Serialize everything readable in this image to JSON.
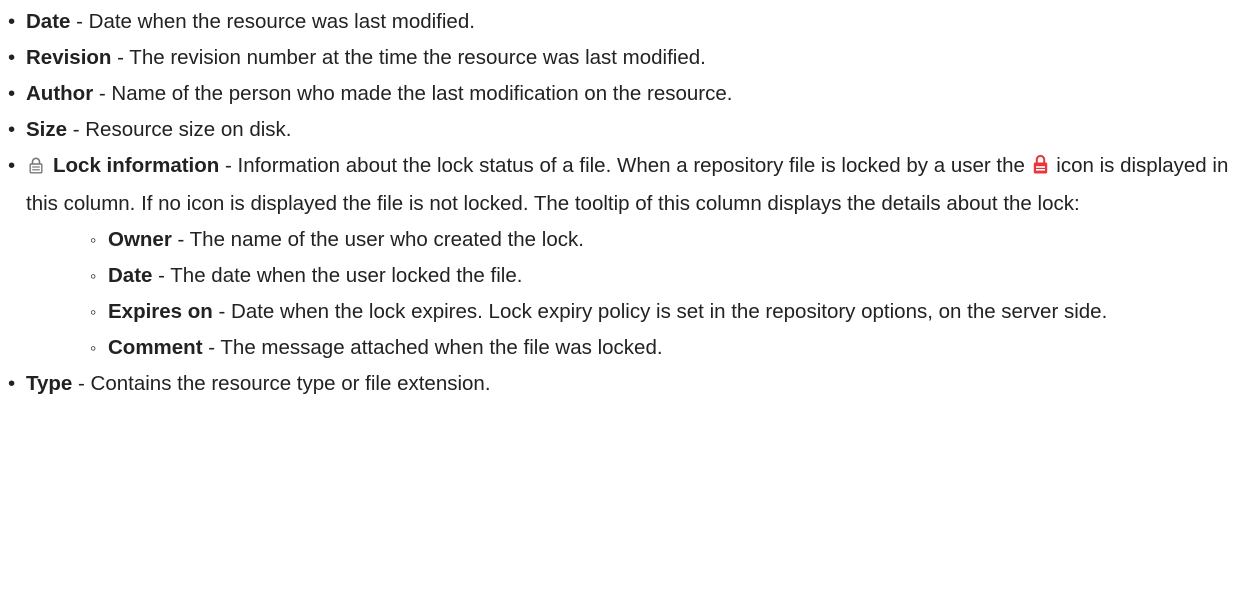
{
  "items": [
    {
      "term": "Date",
      "desc": " - Date when the resource was last modified."
    },
    {
      "term": "Revision",
      "desc": " - The revision number at the time the resource was last modified."
    },
    {
      "term": "Author",
      "desc": " - Name of the person who made the last modification on the resource."
    },
    {
      "term": "Size",
      "desc": " - Resource size on disk."
    }
  ],
  "lock_item": {
    "icon": "lock-gray-icon",
    "term": "Lock information",
    "desc_before_icon": " - Information about the lock status of a file. When a repository file is locked by a user the ",
    "inline_icon": "lock-red-icon",
    "desc_after_icon": " icon is displayed in this column. If no icon is displayed the file is not locked. The tooltip of this column displays the details about the lock:",
    "sub_items": [
      {
        "term": "Owner",
        "desc": " - The name of the user who created the lock."
      },
      {
        "term": "Date",
        "desc": " - The date when the user locked the file."
      },
      {
        "term": "Expires on",
        "desc": " - Date when the lock expires. Lock expiry policy is set in the repository options, on the server side."
      },
      {
        "term": "Comment",
        "desc": " - The message attached when the file was locked."
      }
    ]
  },
  "last_item": {
    "term": "Type",
    "desc": " - Contains the resource type or file extension."
  },
  "colors": {
    "text": "#222222",
    "lock_gray": "#777777",
    "lock_red": "#e8363c"
  }
}
